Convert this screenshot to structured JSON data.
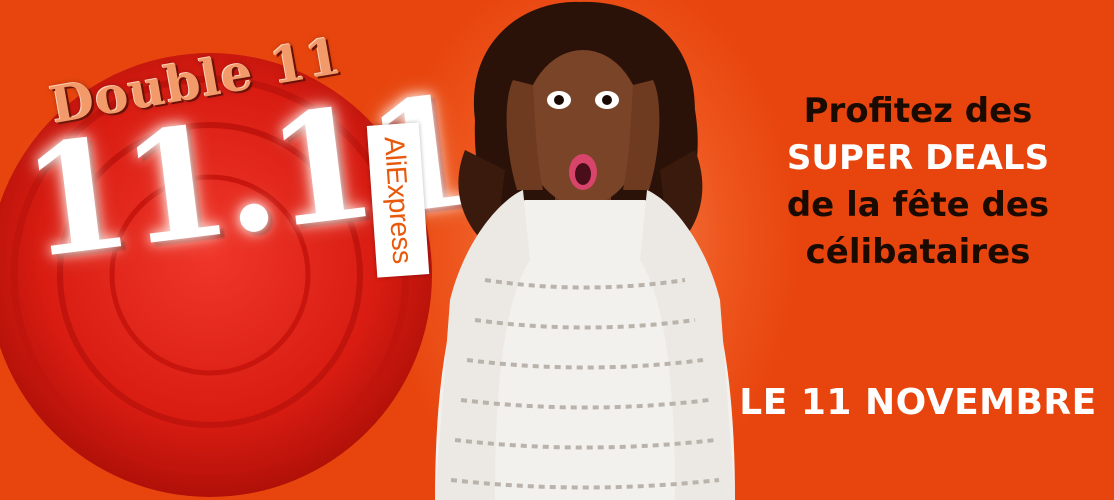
{
  "banner": {
    "colors": {
      "background": "#e8450e",
      "badge_red": "#d81c12",
      "highlight_text": "#ffffff",
      "dark_text": "#1a0a00",
      "brand_orange": "#e8590c"
    },
    "badge": {
      "label": "Double 11",
      "number": "11.11",
      "brand": "AliExpress"
    },
    "promo": {
      "lines": [
        "Profitez des",
        "SUPER DEALS",
        "de la fête des",
        "célibataires"
      ]
    },
    "date": "LE 11 NOVEMBRE",
    "photo": {
      "icon": "surprised-woman-photo"
    }
  }
}
